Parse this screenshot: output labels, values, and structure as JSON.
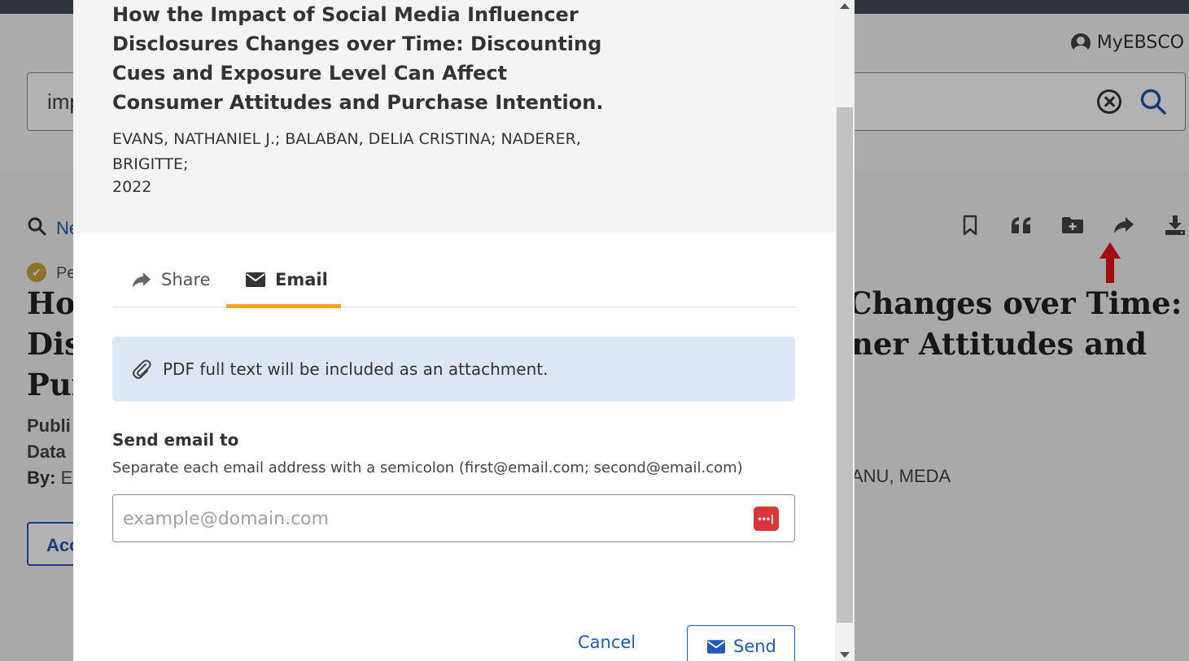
{
  "background": {
    "myebsco_label": "MyEBSCO",
    "search_text": "imp",
    "new_search_link": "Ne",
    "peer_label": "Pe",
    "title_left_lines": [
      "Hov",
      "Dis",
      "Pur"
    ],
    "title_right_lines": [
      "Changes over Time:",
      "ner Attitudes and"
    ],
    "meta_left_lines": [
      "Publi",
      "Data",
      "By:"
    ],
    "by_value": "E",
    "authors_right": "ANU, MEDA",
    "access_button": "Acc"
  },
  "modal": {
    "title": "How the Impact of Social Media Influencer Disclosures Changes over Time: Discounting Cues and Exposure Level Can Affect Consumer Attitudes and Purchase Intention.",
    "authors": "EVANS, NATHANIEL J.; BALABAN, DELIA CRISTINA; NADERER, BRIGITTE;",
    "year": "2022",
    "tabs": {
      "share": "Share",
      "email": "Email"
    },
    "info": "PDF full text will be included as an attachment.",
    "field_label": "Send email to",
    "field_help": "Separate each email address with a semicolon (first@email.com; second@email.com)",
    "email_placeholder": "example@domain.com",
    "email_value": "",
    "cancel_label": "Cancel",
    "send_label": "Send"
  },
  "colors": {
    "accent": "#f0a526",
    "link": "#1f5ab3",
    "info_bg": "#dce6f5",
    "annotation": "#e8141e"
  }
}
